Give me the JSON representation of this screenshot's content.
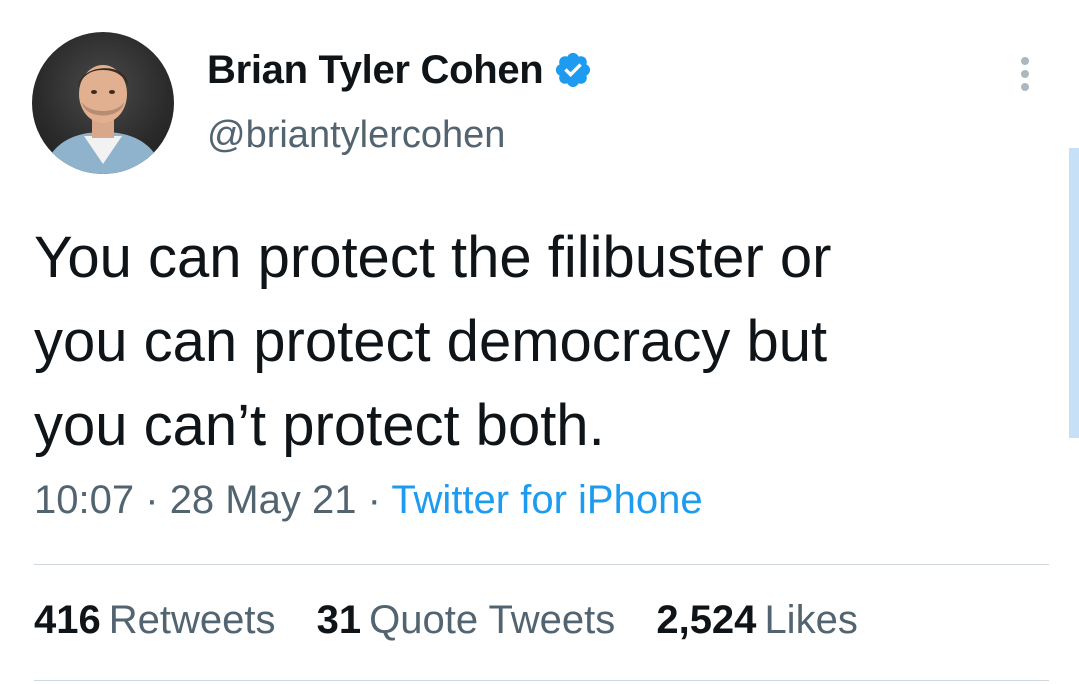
{
  "author": {
    "display_name": "Brian Tyler Cohen",
    "handle": "@briantylercohen",
    "verified": true
  },
  "tweet": {
    "lines": [
      "You can protect the filibuster or",
      "you can protect democracy but",
      "you can’t protect both."
    ],
    "time": "10:07",
    "date": "28 May 21",
    "separator": "·",
    "source": "Twitter for iPhone"
  },
  "stats": {
    "retweets": {
      "count": "416",
      "label": "Retweets"
    },
    "quotes": {
      "count": "31",
      "label": "Quote Tweets"
    },
    "likes": {
      "count": "2,524",
      "label": "Likes"
    }
  },
  "icons": {
    "verified": "verified-badge-icon",
    "more": "more-options-icon"
  },
  "colors": {
    "text": "#0f1419",
    "secondary": "#536471",
    "accent": "#1d9bf0",
    "divider": "#cfd9de"
  }
}
